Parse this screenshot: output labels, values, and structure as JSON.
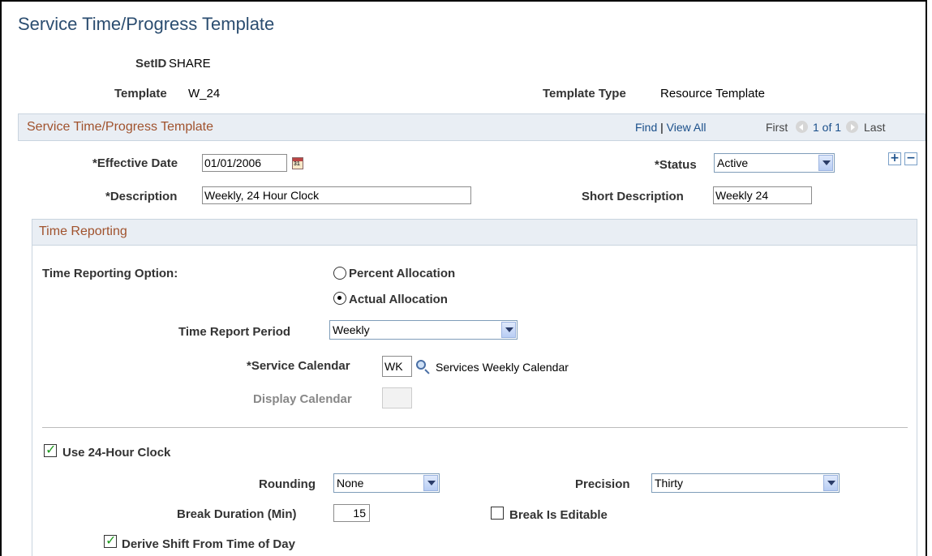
{
  "page": {
    "title": "Service Time/Progress Template"
  },
  "header": {
    "setid_label": "SetID",
    "setid_value": "SHARE",
    "template_label": "Template",
    "template_value": "W_24",
    "template_type_label": "Template Type",
    "template_type_value": "Resource Template"
  },
  "section": {
    "title": "Service Time/Progress Template",
    "find": "Find",
    "separator": "|",
    "view_all": "View All",
    "first": "First",
    "range": "1 of 1",
    "last": "Last"
  },
  "fields": {
    "effective_date_label": "*Effective Date",
    "effective_date_value": "01/01/2006",
    "status_label": "*Status",
    "status_value": "Active",
    "description_label": "*Description",
    "description_value": "Weekly, 24 Hour Clock",
    "short_description_label": "Short Description",
    "short_description_value": "Weekly 24"
  },
  "time_reporting": {
    "title": "Time Reporting",
    "option_label": "Time Reporting Option:",
    "percent_allocation": "Percent Allocation",
    "actual_allocation": "Actual Allocation",
    "selected_option": "Actual Allocation",
    "report_period_label": "Time Report Period",
    "report_period_value": "Weekly",
    "service_calendar_label": "*Service Calendar",
    "service_calendar_value": "WK",
    "service_calendar_desc": "Services Weekly Calendar",
    "display_calendar_label": "Display Calendar",
    "display_calendar_value": "",
    "use_24_hour_label": "Use 24-Hour Clock",
    "use_24_hour_checked": true,
    "rounding_label": "Rounding",
    "rounding_value": "None",
    "precision_label": "Precision",
    "precision_value": "Thirty",
    "break_duration_label": "Break Duration (Min)",
    "break_duration_value": "15",
    "break_editable_label": "Break Is Editable",
    "break_editable_checked": false,
    "derive_shift_label": "Derive Shift From Time of Day",
    "derive_shift_checked": true
  },
  "icons": [
    "calendar-icon",
    "lookup-icon",
    "add-row-icon",
    "delete-row-icon",
    "previous-icon",
    "next-icon",
    "dropdown-arrow-icon"
  ]
}
